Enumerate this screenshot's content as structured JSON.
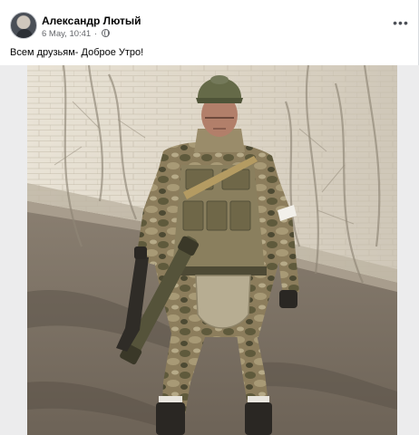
{
  "post": {
    "author": "Александр Лютый",
    "date": "6 May, 10:41",
    "separator": "·",
    "privacy_icon": "globe-icon",
    "more_icon": "more-options-icon",
    "more_glyph": "•••",
    "text": "Всем друзьям- Доброе Утро!"
  },
  "photo": {
    "subject": "soldier-in-camouflage-photo"
  },
  "colors": {
    "author_text": "#050505",
    "meta_text": "#65676b",
    "card_bg": "#ffffff",
    "frame_bg": "#ececed"
  }
}
